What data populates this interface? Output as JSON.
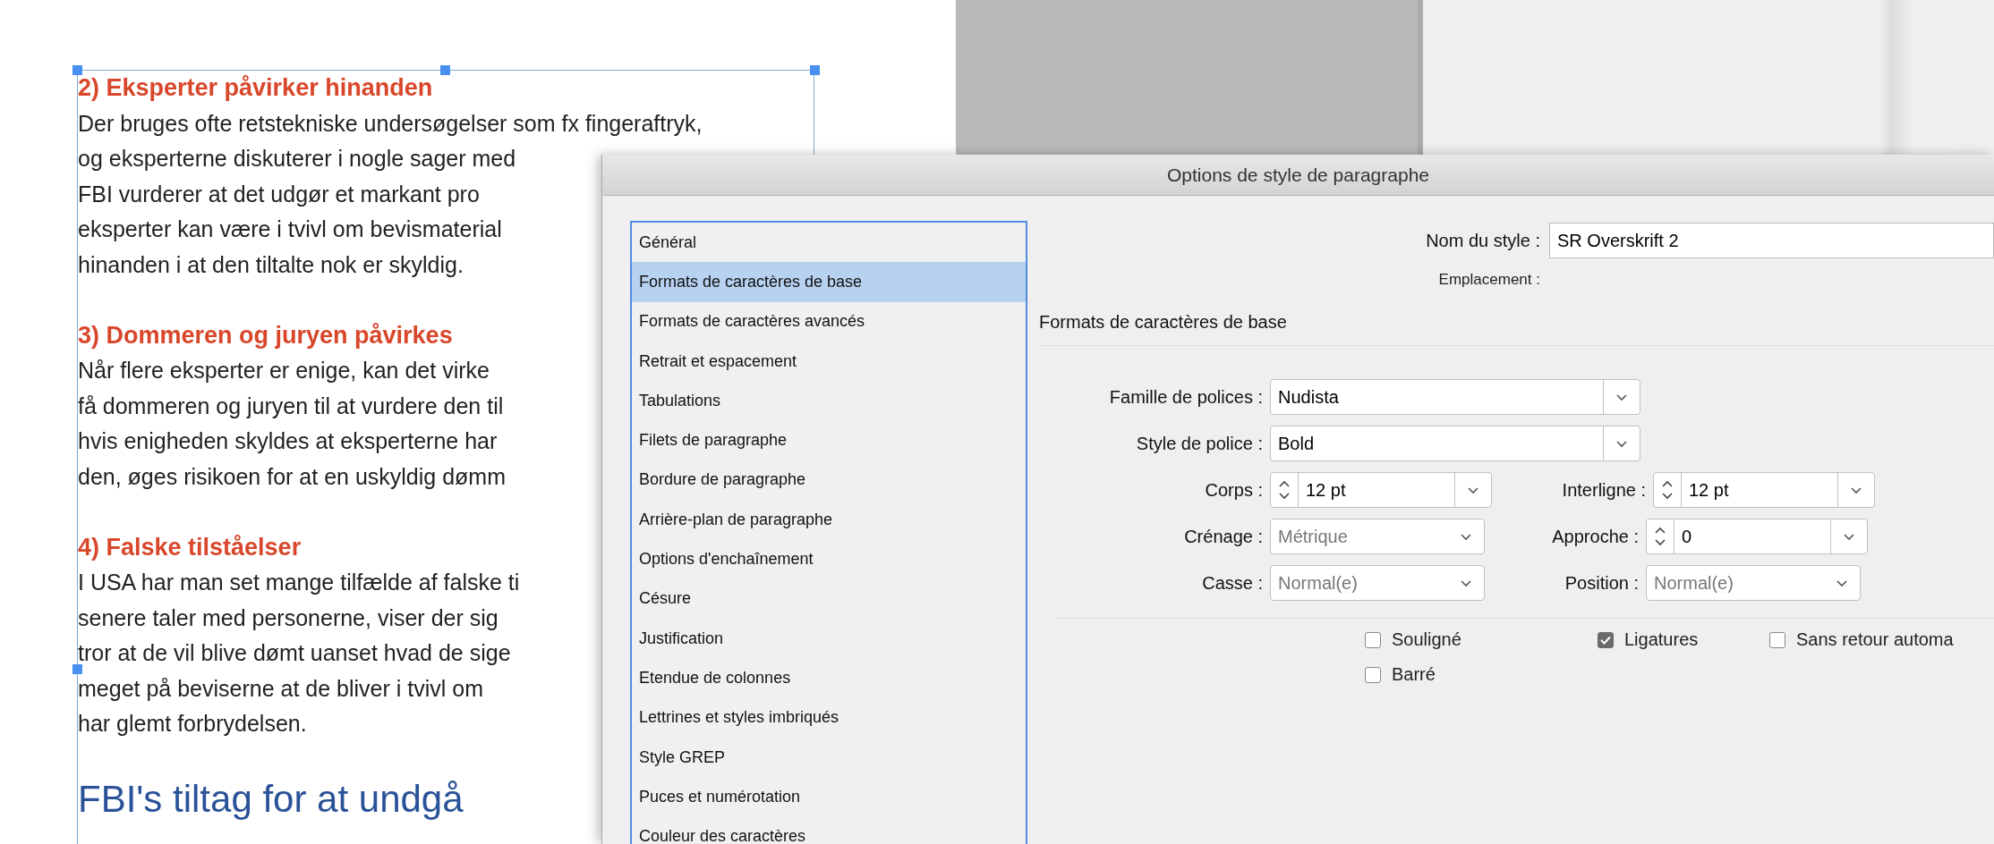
{
  "document": {
    "sections": [
      {
        "heading": "2) Eksperter påvirker hinanden",
        "lines": [
          "Der bruges ofte retstekniske undersøgelser som fx fingeraftryk,",
          "og eksperterne diskuterer i nogle sager med",
          "FBI vurderer at det udgør et markant pro",
          "eksperter kan være i tvivl om bevismaterial",
          "hinanden i at den tiltalte nok er skyldig."
        ]
      },
      {
        "heading": "3) Dommeren og juryen påvirkes",
        "lines": [
          "Når flere eksperter er enige, kan det virke",
          "få dommeren og juryen til at vurdere den til",
          "hvis enigheden skyldes at eksperterne har",
          "den, øges risikoen for at en uskyldig dømm"
        ]
      },
      {
        "heading": "4) Falske tilståelser",
        "lines": [
          "I USA har man set mange tilfælde af falske ti",
          "senere taler med personerne, viser der sig",
          "tror at de vil blive dømt uanset hvad de sige",
          "meget på beviserne at de bliver i tvivl om",
          "har glemt forbrydelsen."
        ]
      }
    ],
    "next_heading": "FBI's tiltag for at undgå"
  },
  "dialog": {
    "title": "Options de style de paragraphe",
    "categories": [
      {
        "label": "Général",
        "selected": false
      },
      {
        "label": "Formats de caractères de base",
        "selected": true
      },
      {
        "label": "Formats de caractères avancés",
        "selected": false
      },
      {
        "label": "Retrait et espacement",
        "selected": false
      },
      {
        "label": "Tabulations",
        "selected": false
      },
      {
        "label": "Filets de paragraphe",
        "selected": false
      },
      {
        "label": "Bordure de paragraphe",
        "selected": false
      },
      {
        "label": "Arrière-plan de paragraphe",
        "selected": false
      },
      {
        "label": "Options d'enchaînement",
        "selected": false
      },
      {
        "label": "Césure",
        "selected": false
      },
      {
        "label": "Justification",
        "selected": false
      },
      {
        "label": "Etendue de colonnes",
        "selected": false
      },
      {
        "label": "Lettrines et styles imbriqués",
        "selected": false
      },
      {
        "label": "Style GREP",
        "selected": false
      },
      {
        "label": "Puces et numérotation",
        "selected": false
      },
      {
        "label": "Couleur des caractères",
        "selected": false
      }
    ],
    "style_name": {
      "label": "Nom du style :",
      "value": "SR Overskrift 2"
    },
    "location_label": "Emplacement :",
    "section_title": "Formats de caractères de base",
    "rows": [
      {
        "fields": [
          {
            "label": "Famille de polices :",
            "value": "Nudista",
            "kind": "combo"
          }
        ]
      },
      {
        "fields": [
          {
            "label": "Style de police :",
            "value": "Bold",
            "kind": "combo"
          }
        ]
      },
      {
        "fields": [
          {
            "label": "Corps :",
            "value": "12 pt",
            "kind": "spinner"
          },
          {
            "label": "Interligne :",
            "value": "12 pt",
            "kind": "spinner"
          }
        ]
      },
      {
        "fields": [
          {
            "label": "Crénage :",
            "value": "Métrique",
            "kind": "dropdown"
          },
          {
            "label": "Approche :",
            "value": "0",
            "kind": "spinner"
          }
        ]
      },
      {
        "fields": [
          {
            "label": "Casse :",
            "value": "Normal(e)",
            "kind": "dropdown"
          },
          {
            "label": "Position :",
            "value": "Normal(e)",
            "kind": "dropdown"
          }
        ]
      }
    ],
    "option_rows": [
      {
        "options": [
          {
            "label": "Souligné",
            "checked": false
          },
          {
            "label": "Ligatures",
            "checked": true
          },
          {
            "label": "Sans retour automa",
            "checked": false
          }
        ]
      },
      {
        "options": [
          {
            "label": "Barré",
            "checked": false
          }
        ]
      }
    ]
  }
}
